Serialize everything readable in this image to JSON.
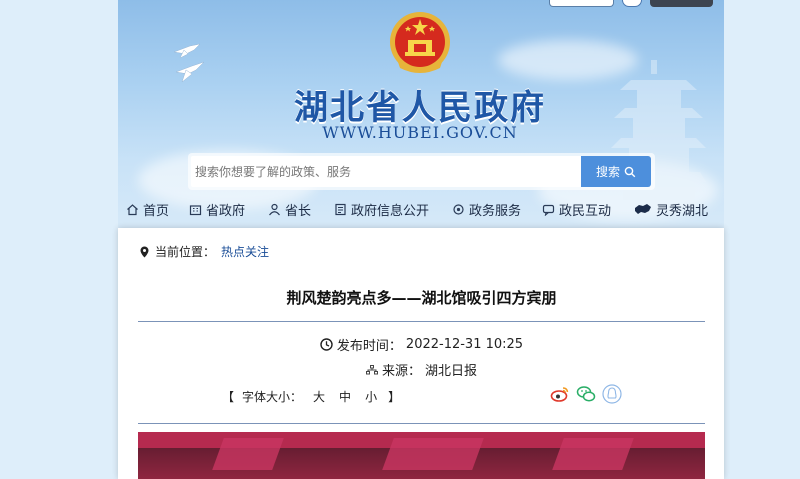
{
  "site": {
    "title": "湖北省人民政府",
    "url": "WWW.HUBEI.GOV.CN"
  },
  "search": {
    "placeholder": "搜索你想要了解的政策、服务",
    "button_label": "搜索"
  },
  "nav": {
    "items": [
      {
        "label": "首页",
        "icon": "home-icon"
      },
      {
        "label": "省政府",
        "icon": "building-icon"
      },
      {
        "label": "省长",
        "icon": "person-icon"
      },
      {
        "label": "政府信息公开",
        "icon": "document-icon"
      },
      {
        "label": "政务服务",
        "icon": "service-icon"
      },
      {
        "label": "政民互动",
        "icon": "chat-icon"
      },
      {
        "label": "灵秀湖北",
        "icon": "hubei-map-icon"
      }
    ]
  },
  "breadcrumb": {
    "prefix": "当前位置：",
    "current": "热点关注"
  },
  "article": {
    "title": "荆风楚韵亮点多——湖北馆吸引四方宾朋",
    "publish_label": "发布时间：",
    "publish_time": "2022-12-31 10:25",
    "source_label": "来源：",
    "source": "湖北日报"
  },
  "font_size": {
    "open": "【",
    "label": "字体大小：",
    "large": "大",
    "medium": "中",
    "small": "小",
    "close": "】"
  },
  "share": [
    "weibo-icon",
    "wechat-icon",
    "qq-icon"
  ],
  "colors": {
    "brand_blue": "#1f57a6",
    "search_button": "#4d8fdc",
    "title_text": "#111111"
  }
}
